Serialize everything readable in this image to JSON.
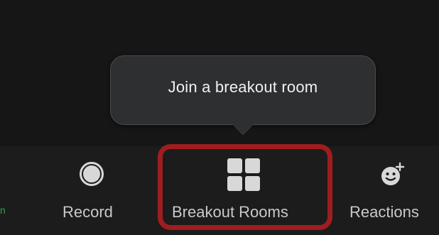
{
  "tooltip": {
    "text": "Join a breakout room"
  },
  "toolbar": {
    "left_edge_fragment": "n",
    "record_label": "Record",
    "breakout_label": "Breakout Rooms",
    "reactions_label": "Reactions"
  },
  "icons": {
    "record": "record-icon",
    "breakout": "grid-icon",
    "reactions": "smiley-plus-icon"
  },
  "colors": {
    "background": "#151515",
    "toolbar_bg": "#1c1c1c",
    "tooltip_bg": "#2e2f31",
    "label": "#c9c9c9",
    "highlight": "#a01d1f",
    "left_edge_text": "#2ea043"
  }
}
